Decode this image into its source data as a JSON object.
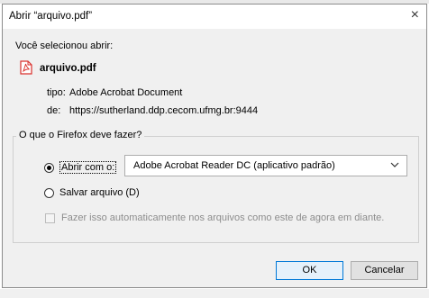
{
  "dialog": {
    "title": "Abrir “arquivo.pdf”",
    "close_glyph": "×",
    "selected_label": "Você selecionou abrir:",
    "file": {
      "icon": "pdf-icon",
      "name": "arquivo.pdf",
      "type_label": "tipo:",
      "type_value": "Adobe Acrobat Document",
      "from_label": "de:",
      "from_value": "https://sutherland.ddp.cecom.ufmg.br:9444"
    },
    "action_group": {
      "legend": "O que o Firefox deve fazer?",
      "open_with": {
        "label": "Abrir com o:",
        "checked": true,
        "app": "Adobe Acrobat Reader DC  (aplicativo padrão)"
      },
      "save_file": {
        "label": "Salvar arquivo (D)",
        "checked": false
      },
      "auto_checkbox": {
        "label": "Fazer isso automaticamente nos arquivos como este de agora em diante.",
        "checked": false,
        "enabled": false
      }
    },
    "buttons": {
      "ok": "OK",
      "cancel": "Cancelar"
    }
  },
  "colors": {
    "dialog_bg": "#f0f0f0",
    "accent": "#0078d7",
    "pdf_red": "#d9302c",
    "disabled_text": "#8d8d8d"
  }
}
